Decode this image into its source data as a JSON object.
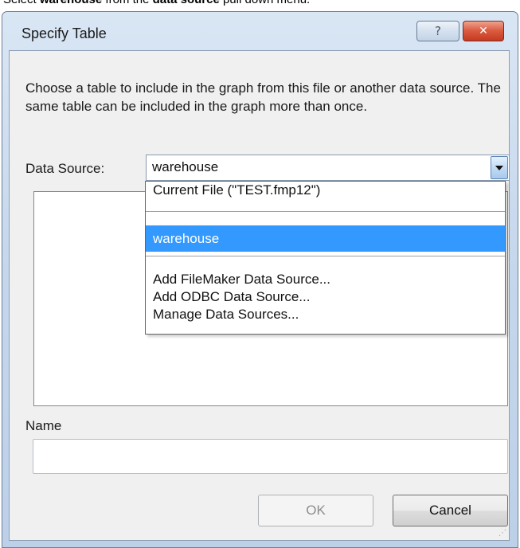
{
  "caption": {
    "part1": "Select ",
    "bold1": "warehouse",
    "part2": " from the ",
    "bold2": "data source",
    "part3": " pull down menu."
  },
  "dialog": {
    "title": "Specify Table",
    "help_glyph": "?",
    "close_glyph": "✕",
    "description": "Choose a table to include in the graph from this file or another data source.  The same table can be included in the graph more than once.",
    "data_source_label": "Data Source:",
    "data_source_value": "warehouse",
    "dropdown_items": {
      "current_file": "Current File (\"TEST.fmp12\")",
      "warehouse": "warehouse",
      "add_filemaker": "Add FileMaker Data Source...",
      "add_odbc": "Add ODBC Data Source...",
      "manage": "Manage Data Sources..."
    },
    "selected_item": "warehouse",
    "name_label": "Name",
    "name_value": "",
    "ok_label": "OK",
    "cancel_label": "Cancel"
  },
  "colors": {
    "selection": "#3399ff",
    "close_button": "#db5b40"
  }
}
